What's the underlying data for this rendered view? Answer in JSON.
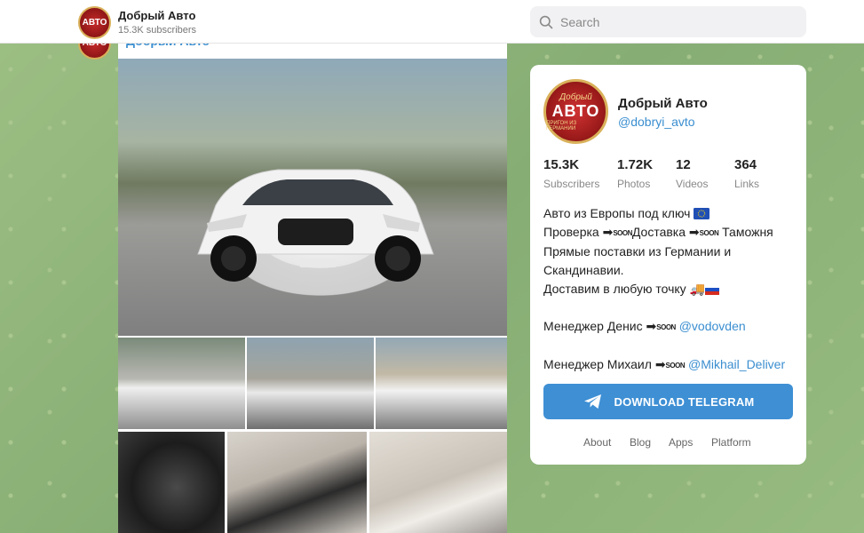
{
  "header": {
    "channel_title": "Добрый Авто",
    "channel_subscribers": "15.3K subscribers",
    "avatar_text": "АВТО",
    "search": {
      "placeholder": "Search",
      "value": ""
    }
  },
  "post": {
    "author": "Добрый Авто",
    "avatar_text": "АВТО",
    "photo_count": 7
  },
  "profile": {
    "avatar_logo_top": "Добрый",
    "avatar_logo_main": "АВТО",
    "avatar_logo_sub": "ПРИГОН ИЗ ГЕРМАНИИ",
    "name": "Добрый Авто",
    "handle": "@dobryi_avto",
    "stats": [
      {
        "value": "15.3K",
        "label": "Subscribers"
      },
      {
        "value": "1.72K",
        "label": "Photos"
      },
      {
        "value": "12",
        "label": "Videos"
      },
      {
        "value": "364",
        "label": "Links"
      }
    ],
    "description": {
      "line1": "Авто из Европы под ключ",
      "line2_a": "Проверка",
      "line2_b": "Доставка",
      "line2_c": "Таможня",
      "line3": "Прямые поставки из Германии и",
      "line4": "Скандинавии.",
      "line5": "Доставим в любую точку",
      "line6_text": "Менеджер Денис",
      "line6_link": "@vodovden",
      "line7_text": "Менеджер Михаил",
      "line7_link": "@Mikhail_Deliver",
      "soon_label": "SOON"
    },
    "download_label": "DOWNLOAD TELEGRAM",
    "footer_links": [
      "About",
      "Blog",
      "Apps",
      "Platform"
    ]
  },
  "colors": {
    "accent": "#3e8fd4",
    "link": "#3a8ed0",
    "brand_red": "#9a1a1a",
    "brand_gold": "#d9b15a",
    "background": "#8fb37a"
  }
}
